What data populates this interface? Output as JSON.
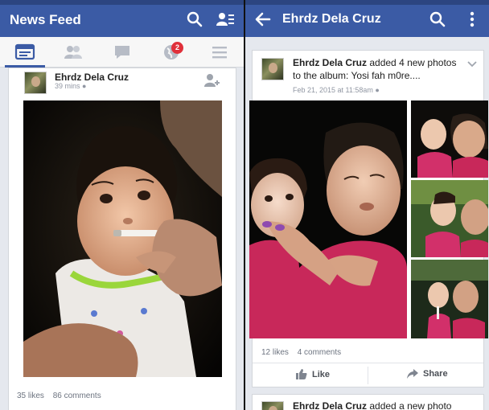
{
  "left": {
    "header": {
      "title": "News Feed"
    },
    "tabs": [
      {
        "name": "news-feed",
        "icon": "news-feed-icon",
        "active": true
      },
      {
        "name": "friend-requests",
        "icon": "friends-icon"
      },
      {
        "name": "messages",
        "icon": "messages-icon"
      },
      {
        "name": "notifications",
        "icon": "globe-icon",
        "badge": "2"
      },
      {
        "name": "more",
        "icon": "menu-icon"
      }
    ],
    "post": {
      "author": "Ehrdz Dela Cruz",
      "time": "39 mins",
      "likes": "35 likes",
      "comments": "86 comments"
    }
  },
  "right": {
    "header": {
      "title": "Ehrdz Dela Cruz"
    },
    "post": {
      "author": "Ehrdz Dela Cruz",
      "story_text": "added 4 new photos to the album: Yosi fah m0re....",
      "time": "Feb 21, 2015 at 11:58am",
      "likes": "12 likes",
      "comments": "4 comments",
      "like_label": "Like",
      "share_label": "Share"
    },
    "next_post": {
      "author": "Ehrdz Dela Cruz",
      "story_text": "added a new photo"
    }
  },
  "colors": {
    "brand": "#3b5ba5",
    "badge": "#e0303a",
    "pink_shirt": "#c8285a"
  }
}
